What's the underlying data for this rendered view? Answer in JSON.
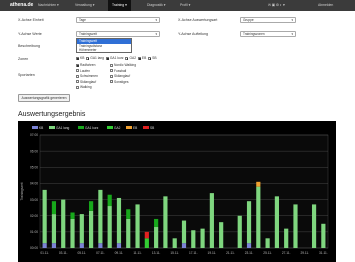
{
  "nav": {
    "brand": "athena.de",
    "items": [
      "Nachrichten ▾",
      "Verwaltung ▾",
      "Training ▾",
      "Diagnostik ▾",
      "Profil ▾"
    ],
    "active_index": 2,
    "right": "Abmelden"
  },
  "form": {
    "xunit_label": "X-Achse Einheit",
    "xunit_value": "Tage",
    "xgroup_label": "X-Achse Auswertungsart",
    "xgroup_value": "Gruppe",
    "yvalues_label": "Y-Achse Werte",
    "yvalues_value": "Trainingszeit",
    "ysplit_label": "Y-Achse Aufteilung",
    "ysplit_value": "Trainingszonen",
    "dropdown_options": [
      "Trainingszeit",
      "Trainingsdistanz",
      "Höhenmeter"
    ],
    "dropdown_highlight": 0,
    "desc_label": "Beschreibung",
    "zones_label": "Zonen",
    "zones": [
      {
        "label": "KB",
        "checked": true
      },
      {
        "label": "GA1 lang",
        "checked": true
      },
      {
        "label": "GA1 kurz",
        "checked": true
      },
      {
        "label": "GA2",
        "checked": true
      },
      {
        "label": "EB",
        "checked": true
      },
      {
        "label": "SB",
        "checked": true
      }
    ],
    "sports_label": "Sportarten",
    "sports": [
      {
        "label": "Radfahren",
        "checked": true
      },
      {
        "label": "Nordic Walking",
        "checked": false
      },
      {
        "label": "Laufen",
        "checked": false
      },
      {
        "label": "Fussball",
        "checked": false
      },
      {
        "label": "Schwimmen",
        "checked": false
      },
      {
        "label": "Skilanglauf",
        "checked": false
      },
      {
        "label": "Skilanglauf",
        "checked": false
      },
      {
        "label": "Sonstiges",
        "checked": false
      },
      {
        "label": "Walking",
        "checked": false
      }
    ],
    "button_label": "Auswertungsgrafik generieren"
  },
  "section_title": "Auswertungsergebnis",
  "chart_data": {
    "type": "bar",
    "title": "",
    "ylabel": "Trainingszeit",
    "ylim": [
      0,
      7
    ],
    "yticks": [
      "00:00",
      "01:00",
      "02:00",
      "03:00",
      "04:00",
      "05:00",
      "06:00",
      "07:00"
    ],
    "categories": [
      "01.",
      "02.",
      "03.",
      "04.",
      "05.",
      "06.",
      "07.",
      "08.",
      "09.",
      "10.",
      "11.",
      "12.",
      "13.",
      "14.",
      "15.",
      "16.",
      "17.",
      "18.",
      "19.",
      "20.",
      "21.",
      "22.",
      "23.",
      "24.",
      "25.",
      "26.",
      "27.",
      "28.",
      "29.",
      "30.",
      "31."
    ],
    "xtick_labels": [
      "01.11.",
      "03.11.",
      "05.11.",
      "07.11.",
      "09.11.",
      "11.11.",
      "13.11.",
      "15.11.",
      "17.11.",
      "19.11.",
      "21.11.",
      "23.11.",
      "25.11.",
      "27.11.",
      "29.11.",
      "31.11."
    ],
    "series": [
      {
        "name": "KB",
        "color": "#7b83d6",
        "values": [
          0.3,
          0.3,
          0,
          0,
          0.3,
          0,
          0.3,
          0,
          0.3,
          0,
          0,
          0,
          0,
          0,
          0,
          0.3,
          0,
          0,
          0,
          0,
          0,
          0,
          0.3,
          0,
          0,
          0,
          0,
          0,
          0,
          0,
          0
        ]
      },
      {
        "name": "GA1 lang",
        "color": "#7fd67f",
        "values": [
          3.3,
          1.8,
          3.0,
          1.8,
          1.8,
          2.3,
          3.3,
          2.6,
          2.8,
          1.8,
          2.7,
          0,
          1.3,
          3.2,
          0.6,
          1.4,
          1.1,
          1.2,
          3.4,
          1.6,
          0,
          2.0,
          2.6,
          3.8,
          0.6,
          3.2,
          1.2,
          2.7,
          0,
          2.7,
          1.5
        ]
      },
      {
        "name": "GA1 kurz",
        "color": "#17a81b",
        "values": [
          0,
          0.8,
          0,
          0.4,
          0,
          0.6,
          0,
          0.7,
          0,
          0.6,
          0,
          0,
          0.5,
          0,
          0,
          0,
          0,
          0,
          0,
          0,
          0,
          0,
          0,
          0,
          0,
          0,
          0,
          0,
          0,
          0,
          0
        ]
      },
      {
        "name": "GA2",
        "color": "#33cc33",
        "values": [
          0,
          0,
          0,
          0,
          0,
          0,
          0,
          0,
          0,
          0,
          0,
          0.6,
          0,
          0,
          0,
          0,
          0,
          0,
          0,
          0,
          0,
          0,
          0,
          0,
          0,
          0,
          0,
          0,
          0,
          0,
          0
        ]
      },
      {
        "name": "EB",
        "color": "#f0a030",
        "values": [
          0,
          0,
          0,
          0,
          0,
          0,
          0,
          0,
          0,
          0,
          0,
          0,
          0,
          0,
          0,
          0,
          0,
          0,
          0,
          0,
          0,
          0,
          0,
          0.3,
          0,
          0,
          0,
          0,
          0,
          0,
          0
        ]
      },
      {
        "name": "SB",
        "color": "#e02020",
        "values": [
          0,
          0,
          0,
          0,
          0,
          0,
          0,
          0,
          0,
          0,
          0,
          0.4,
          0,
          0,
          0,
          0,
          0,
          0,
          0,
          0,
          0,
          0,
          0,
          0,
          0,
          0,
          0,
          0,
          0,
          0,
          0
        ]
      }
    ],
    "legend": "top-left",
    "grid": true
  }
}
